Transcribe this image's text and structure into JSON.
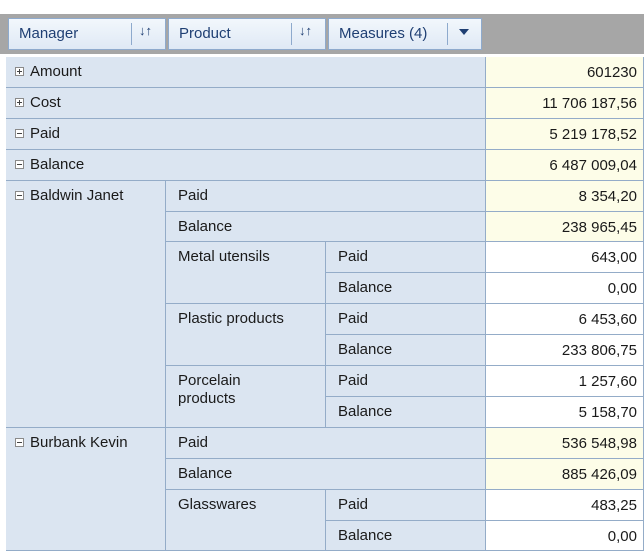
{
  "header": {
    "fields": [
      {
        "label": "Manager",
        "control": "sort-icon"
      },
      {
        "label": "Product",
        "control": "sort-icon"
      },
      {
        "label": "Measures (4)",
        "control": "dropdown-arrow-icon"
      }
    ],
    "sort_glyph": "↓↑"
  },
  "rows": [
    {
      "label": "Amount",
      "state": "collapsed",
      "value": "601230"
    },
    {
      "label": "Cost",
      "state": "collapsed",
      "value": "11 706 187,56"
    },
    {
      "label": "Paid",
      "state": "expanded",
      "value": "5 219 178,52"
    },
    {
      "label": "Balance",
      "state": "expanded",
      "value": "6 487 009,04"
    }
  ],
  "managers": [
    {
      "name": "Baldwin Janet",
      "totals": [
        {
          "measure": "Paid",
          "value": "8 354,20"
        },
        {
          "measure": "Balance",
          "value": "238 965,45"
        }
      ],
      "products": [
        {
          "name": "Metal utensils",
          "measures": [
            {
              "measure": "Paid",
              "value": "643,00"
            },
            {
              "measure": "Balance",
              "value": "0,00"
            }
          ]
        },
        {
          "name": "Plastic products",
          "measures": [
            {
              "measure": "Paid",
              "value": "6 453,60"
            },
            {
              "measure": "Balance",
              "value": "233 806,75"
            }
          ]
        },
        {
          "name_lines": [
            "Porcelain",
            "products"
          ],
          "measures": [
            {
              "measure": "Paid",
              "value": "1 257,60"
            },
            {
              "measure": "Balance",
              "value": "5 158,70"
            }
          ]
        }
      ]
    },
    {
      "name": "Burbank Kevin",
      "totals": [
        {
          "measure": "Paid",
          "value": "536 548,98"
        },
        {
          "measure": "Balance",
          "value": "885 426,09"
        }
      ],
      "products": [
        {
          "name": "Glasswares",
          "measures": [
            {
              "measure": "Paid",
              "value": "483,25"
            },
            {
              "measure": "Balance",
              "value": "0,00"
            }
          ]
        }
      ]
    }
  ]
}
